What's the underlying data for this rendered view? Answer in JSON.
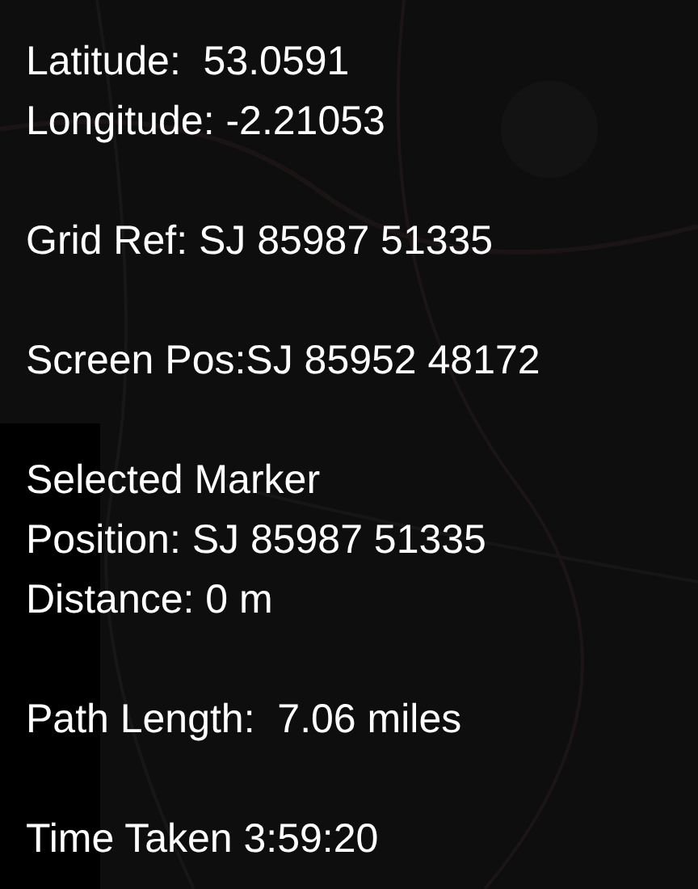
{
  "info_sections": [
    {
      "lines": [
        "Latitude:  53.0591",
        "Longitude: -2.21053"
      ]
    },
    {
      "lines": [
        "Grid Ref: SJ 85987 51335"
      ]
    },
    {
      "lines": [
        "Screen Pos:SJ 85952 48172"
      ]
    },
    {
      "lines": [
        "Selected Marker",
        "Position: SJ 85987 51335",
        "Distance: 0 m"
      ]
    },
    {
      "lines": [
        "Path Length:  7.06 miles"
      ]
    },
    {
      "lines": [
        "Time Taken 3:59:20"
      ]
    }
  ]
}
